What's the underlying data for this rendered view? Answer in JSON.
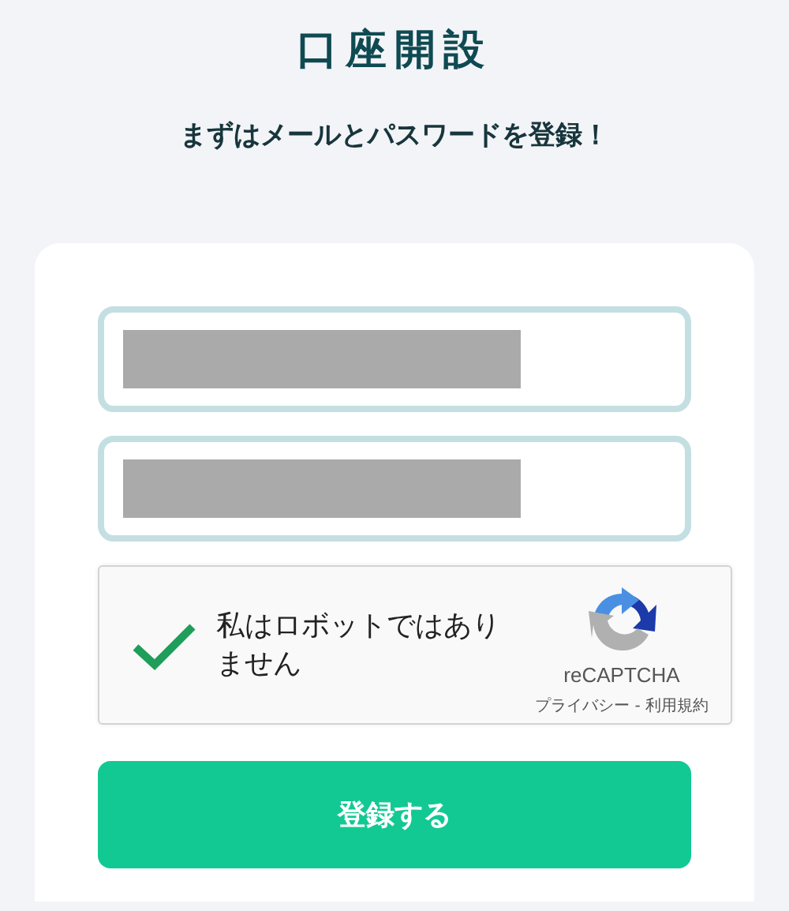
{
  "title": "口座開設",
  "subtitle": "まずはメールとパスワードを登録！",
  "fields": [
    {
      "redacted": true
    },
    {
      "redacted": true
    }
  ],
  "captcha": {
    "checked": true,
    "label": "私はロボットではありません",
    "brand": "reCAPTCHA",
    "privacy": "プライバシー",
    "separator": "-",
    "terms": "利用規約"
  },
  "submit": "登録する"
}
